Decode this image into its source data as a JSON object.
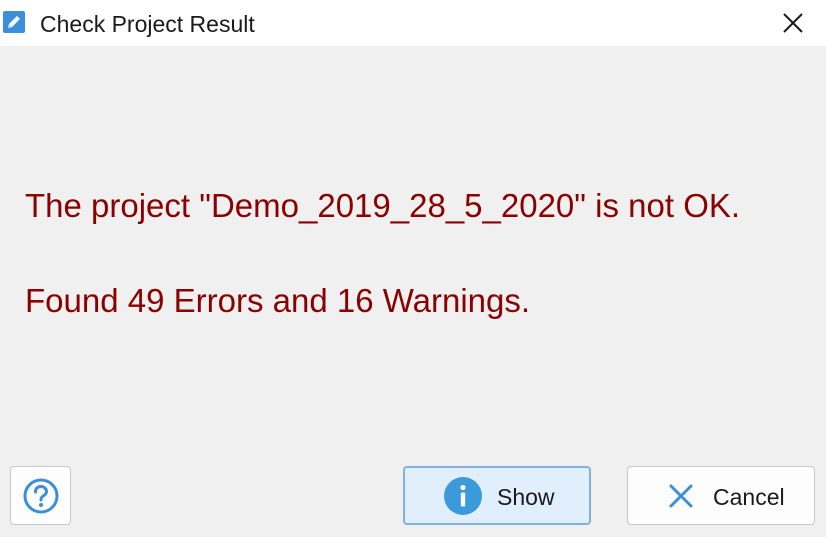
{
  "window": {
    "title": "Check Project Result",
    "app_icon": "pencil-icon",
    "close_icon": "close-icon"
  },
  "message": {
    "line1": "The project \"Demo_2019_28_5_2020\" is not OK.",
    "line2": "Found 49 Errors and 16 Warnings."
  },
  "buttons": {
    "help_icon": "question-circle-icon",
    "show_label": "Show",
    "show_icon": "info-icon",
    "cancel_label": "Cancel",
    "cancel_icon": "x-icon"
  },
  "colors": {
    "message_text": "#8b0000",
    "accent": "#3b8fd9",
    "show_button_bg": "#e1eefb",
    "show_button_border": "#7fb2e3"
  }
}
